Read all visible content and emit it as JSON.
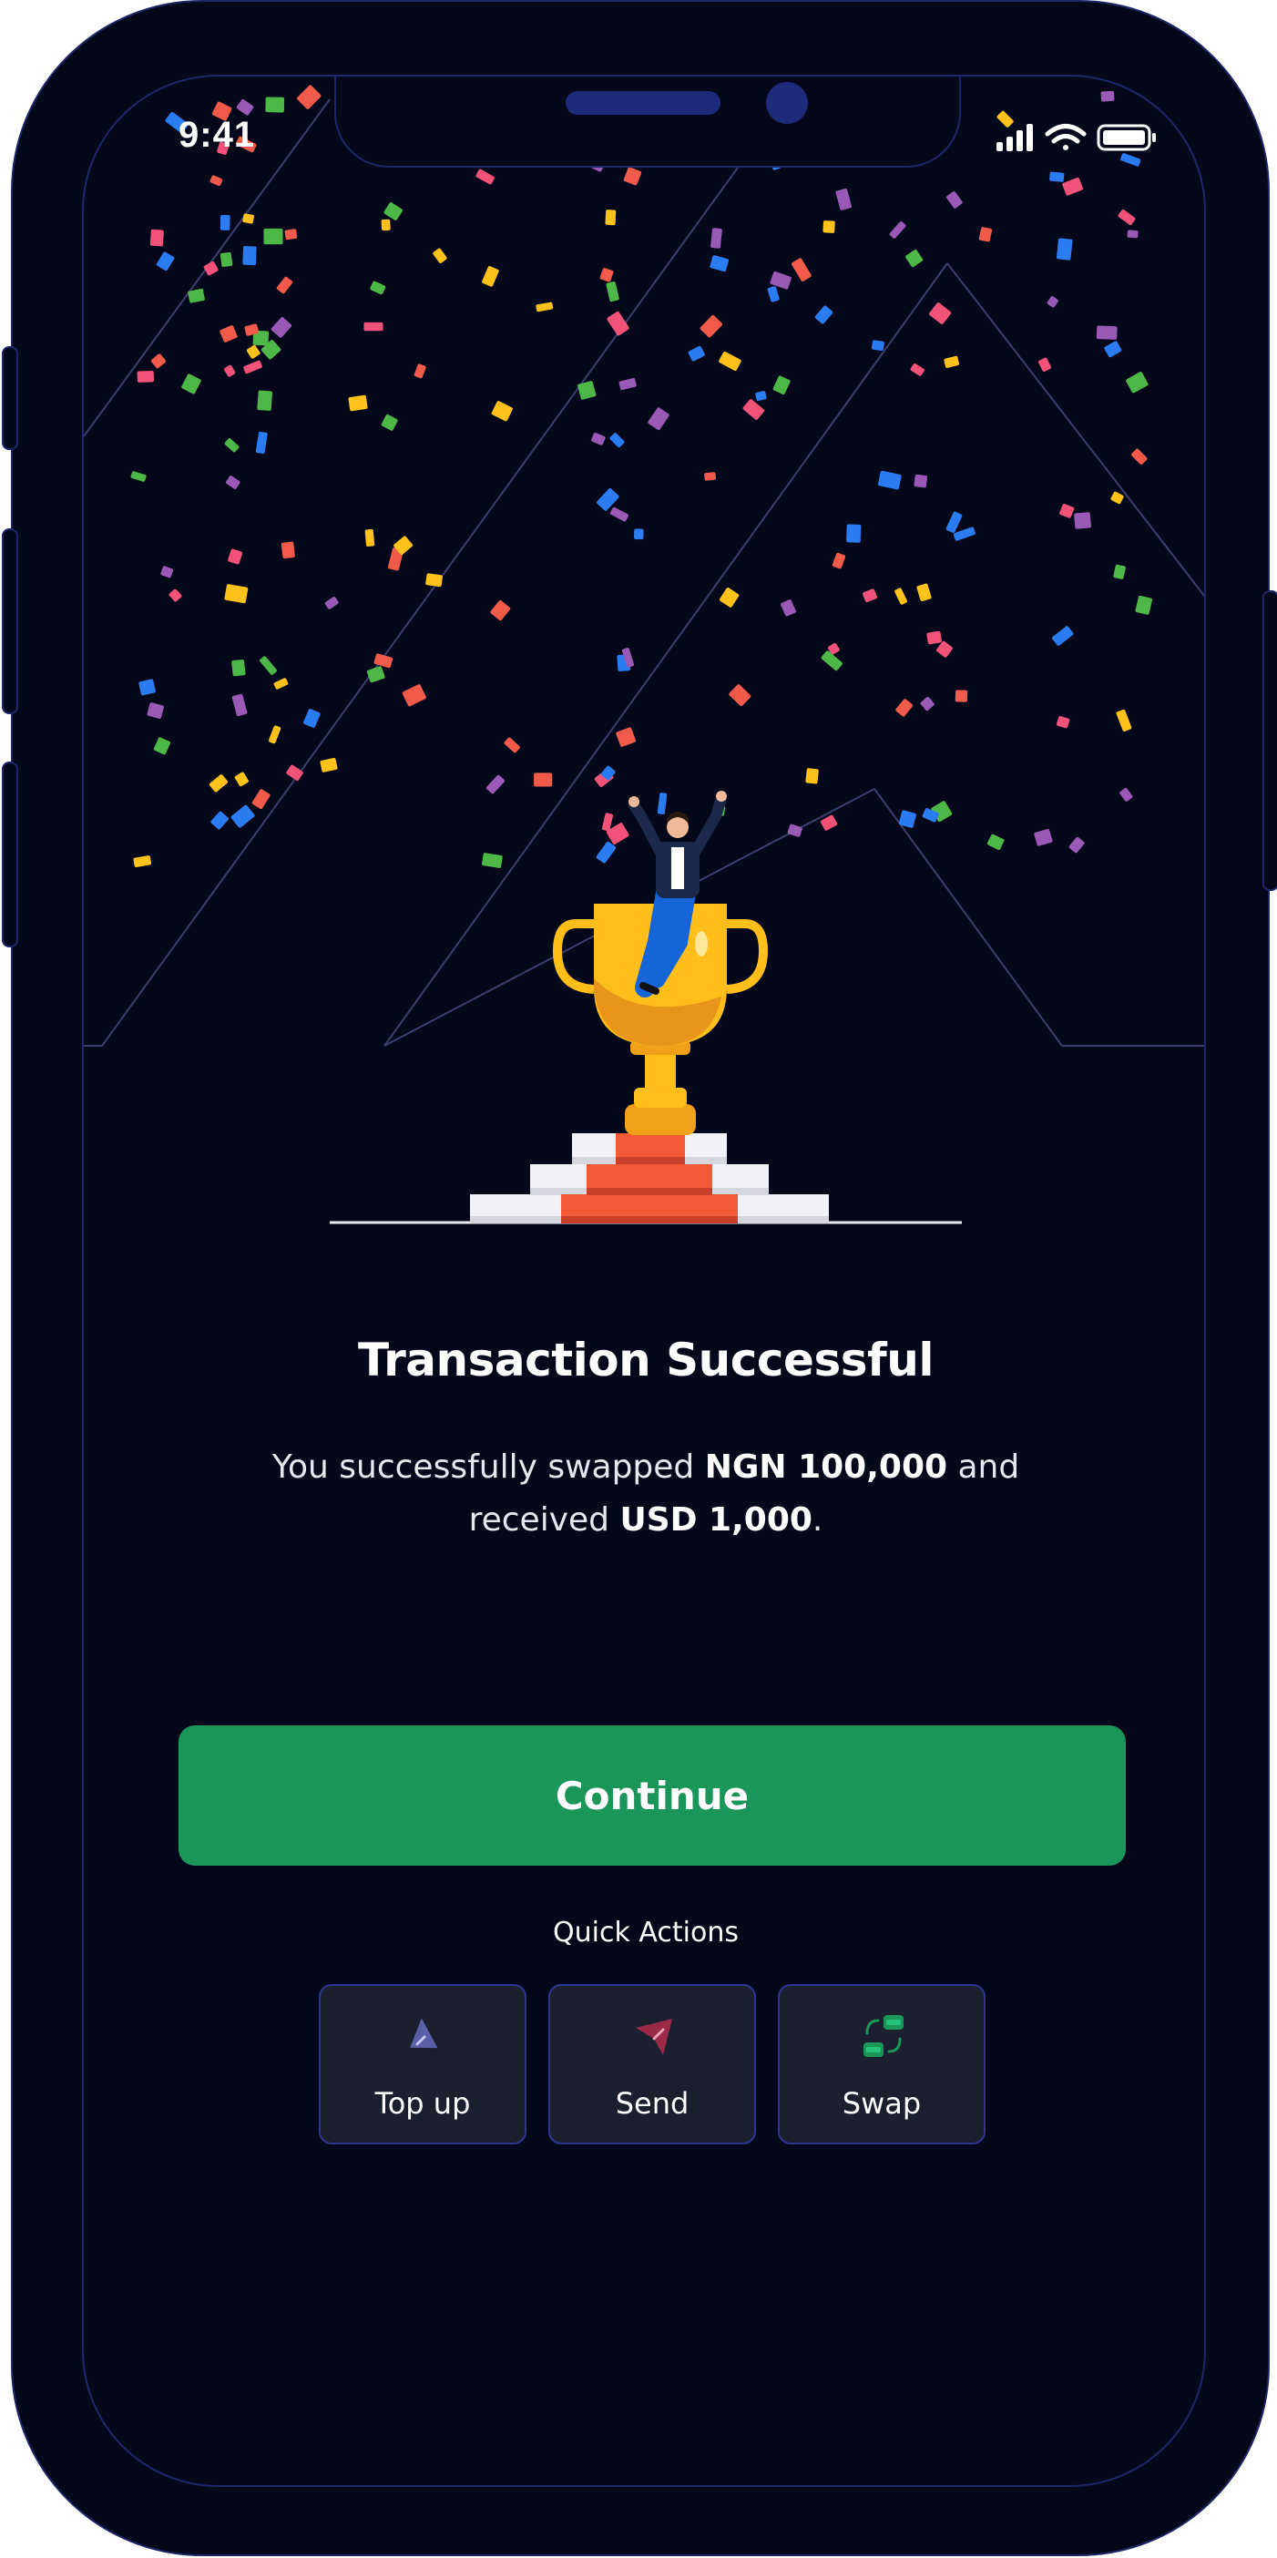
{
  "status_bar": {
    "time": "9:41"
  },
  "illustration": {
    "name": "trophy-celebration"
  },
  "result": {
    "title": "Transaction Successful",
    "message_part1": "You successfully swapped ",
    "amount_from": "NGN 100,000",
    "message_part2": " and received ",
    "amount_to": "USD 1,000",
    "message_part3": "."
  },
  "actions": {
    "continue_label": "Continue",
    "quick_actions_label": "Quick Actions",
    "quick_actions": [
      {
        "label": "Top up",
        "icon": "top-up-icon",
        "color": "#5b5fa8"
      },
      {
        "label": "Send",
        "icon": "send-icon",
        "color": "#9a2a48"
      },
      {
        "label": "Swap",
        "icon": "swap-icon",
        "color": "#1b9659"
      }
    ]
  },
  "colors": {
    "background": "#05081a",
    "accent": "#1b9659",
    "frame": "#1d2766",
    "card": "#1c1f2e"
  }
}
